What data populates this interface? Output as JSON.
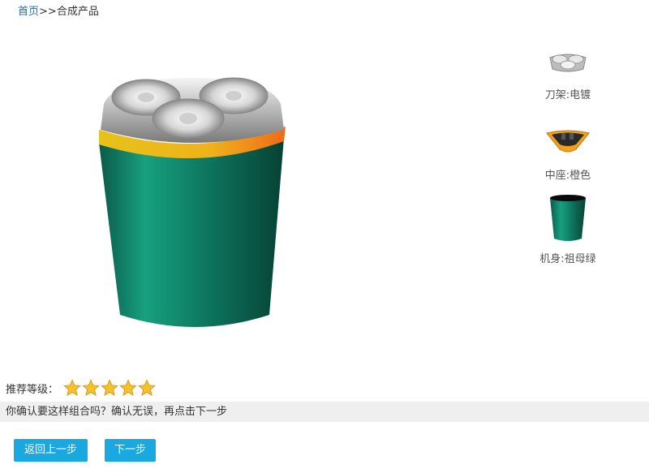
{
  "breadcrumb": {
    "home": "首页",
    "separator": ">>",
    "current": "合成产品"
  },
  "parts": [
    {
      "label": "刀架:电镀",
      "icon": "blade-frame-chrome-icon"
    },
    {
      "label": "中座:橙色",
      "icon": "middle-base-orange-icon"
    },
    {
      "label": "机身:祖母绿",
      "icon": "body-emerald-icon"
    }
  ],
  "rating": {
    "label": "推荐等级：",
    "stars": 5,
    "max": 5
  },
  "confirm_text": "你确认要这样组合吗？确认无误，再点击下一步",
  "buttons": {
    "back": "返回上一步",
    "next": "下一步"
  },
  "colors": {
    "accent": "#1aa8e0",
    "body_green": "#0f7a63",
    "ring_orange": "#f07a1a",
    "ring_yellow": "#e6c21a"
  }
}
